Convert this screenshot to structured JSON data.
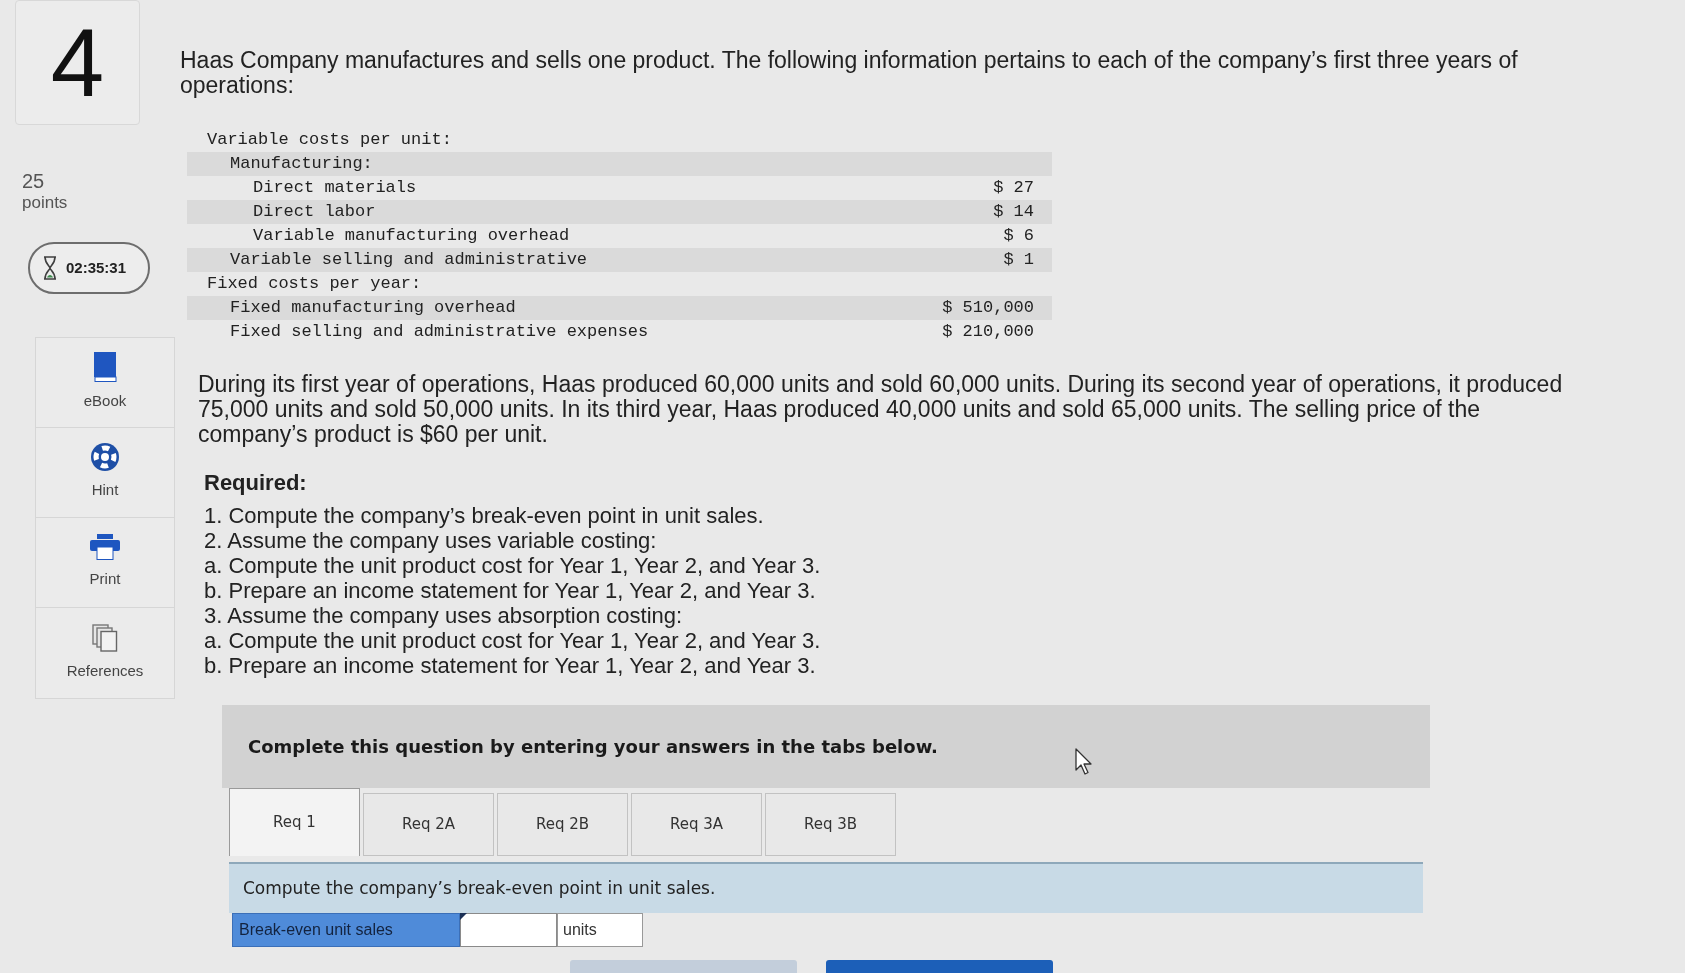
{
  "question": {
    "number": "4",
    "points": "25",
    "points_label": "points",
    "timer": "02:35:31"
  },
  "tools": [
    {
      "label": "eBook",
      "kind": "book"
    },
    {
      "label": "Hint",
      "kind": "lifebuoy"
    },
    {
      "label": "Print",
      "kind": "printer"
    },
    {
      "label": "References",
      "kind": "pages"
    }
  ],
  "intro": "Haas Company manufactures and sells one product. The following information pertains to each of the company’s first three years of operations:",
  "cost_table": {
    "rows": [
      {
        "label": "Variable costs per unit:",
        "children": [
          {
            "label": "Manufacturing:",
            "children": [
              {
                "label": "Direct materials",
                "value": "$ 27"
              },
              {
                "label": "Direct labor",
                "value": "$ 14"
              },
              {
                "label": "Variable manufacturing overhead",
                "value": "$ 6"
              }
            ]
          },
          {
            "label": "Variable selling and administrative",
            "value": "$ 1"
          }
        ]
      },
      {
        "label": "Fixed costs per year:",
        "children": [
          {
            "label": "Fixed manufacturing overhead",
            "value": "$ 510,000"
          },
          {
            "label": "Fixed selling and administrative expenses",
            "value": "$ 210,000"
          }
        ]
      }
    ]
  },
  "scenario": "During its first year of operations, Haas produced 60,000 units and sold 60,000 units. During its second year of operations, it produced 75,000 units and sold 50,000 units. In its third year, Haas produced 40,000 units and sold 65,000 units. The selling price of the company’s product is $60 per unit.",
  "required": {
    "heading": "Required:",
    "items": [
      "1. Compute the company’s break-even point in unit sales.",
      "2. Assume the company uses variable costing:",
      "a. Compute the unit product cost for Year 1, Year 2, and Year 3.",
      "b. Prepare an income statement for Year 1, Year 2, and Year 3.",
      "3. Assume the company uses absorption costing:",
      "a. Compute the unit product cost for Year 1, Year 2, and Year 3.",
      "b. Prepare an income statement for Year 1, Year 2, and Year 3."
    ]
  },
  "instruction": "Complete this question by entering your answers in the tabs below.",
  "tabs": [
    {
      "label": "Req 1",
      "selected": true
    },
    {
      "label": "Req 2A",
      "selected": false
    },
    {
      "label": "Req 2B",
      "selected": false
    },
    {
      "label": "Req 3A",
      "selected": false
    },
    {
      "label": "Req 3B",
      "selected": false
    }
  ],
  "prompt": "Compute the company’s break-even point in unit sales.",
  "answer": {
    "label": "Break-even unit sales",
    "unit": "units"
  },
  "bottom_buttons": [
    {
      "kind": "secondary"
    },
    {
      "kind": "primary"
    }
  ]
}
